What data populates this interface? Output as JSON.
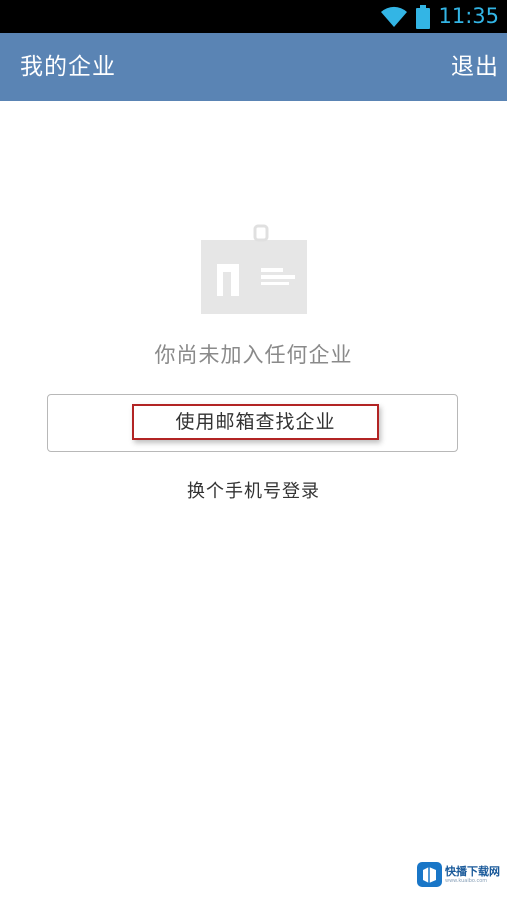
{
  "status_bar": {
    "time": "11:35",
    "icons": [
      "wifi-icon",
      "battery-icon"
    ],
    "color": "#33b5e5"
  },
  "app_bar": {
    "title": "我的企业",
    "logout_label": "退出",
    "background": "#5a84b4"
  },
  "empty_state": {
    "icon": "id-badge-icon",
    "message": "你尚未加入任何企业"
  },
  "actions": {
    "find_by_email_label": "使用邮箱查找企业",
    "switch_phone_label": "换个手机号登录",
    "highlight_color": "#b22424"
  },
  "watermark": {
    "text": "快播下载网",
    "sub_text": "www.kuaibo.com"
  }
}
